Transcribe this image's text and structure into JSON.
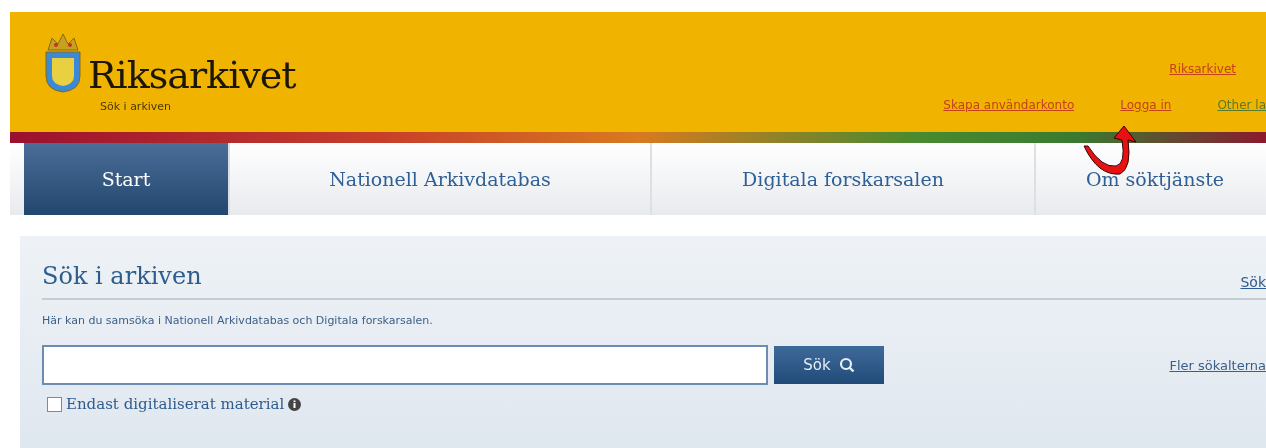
{
  "header": {
    "logo_text": "Riksarkivet",
    "tagline": "Sök i arkiven",
    "top_link": "Riksarkivet",
    "links": [
      {
        "label": "Skapa användarkonto",
        "kind": "account"
      },
      {
        "label": "Logga in",
        "kind": "account"
      },
      {
        "label": "Other la",
        "kind": "language"
      }
    ]
  },
  "nav": {
    "tabs": [
      {
        "label": "Start",
        "selected": true
      },
      {
        "label": "Nationell Arkivdatabas",
        "selected": false
      },
      {
        "label": "Digitala forskarsalen",
        "selected": false
      },
      {
        "label": "Om söktjänste",
        "selected": false
      }
    ]
  },
  "search_panel": {
    "title": "Sök i arkiven",
    "corner_link": "Sök",
    "description": "Här kan du samsöka i Nationell Arkivdatabas och Digitala forskarsalen.",
    "search_button": "Sök",
    "more_link": "Fler sökalterna",
    "filter": {
      "label": "Endast digitaliserat material",
      "checked": false
    }
  }
}
